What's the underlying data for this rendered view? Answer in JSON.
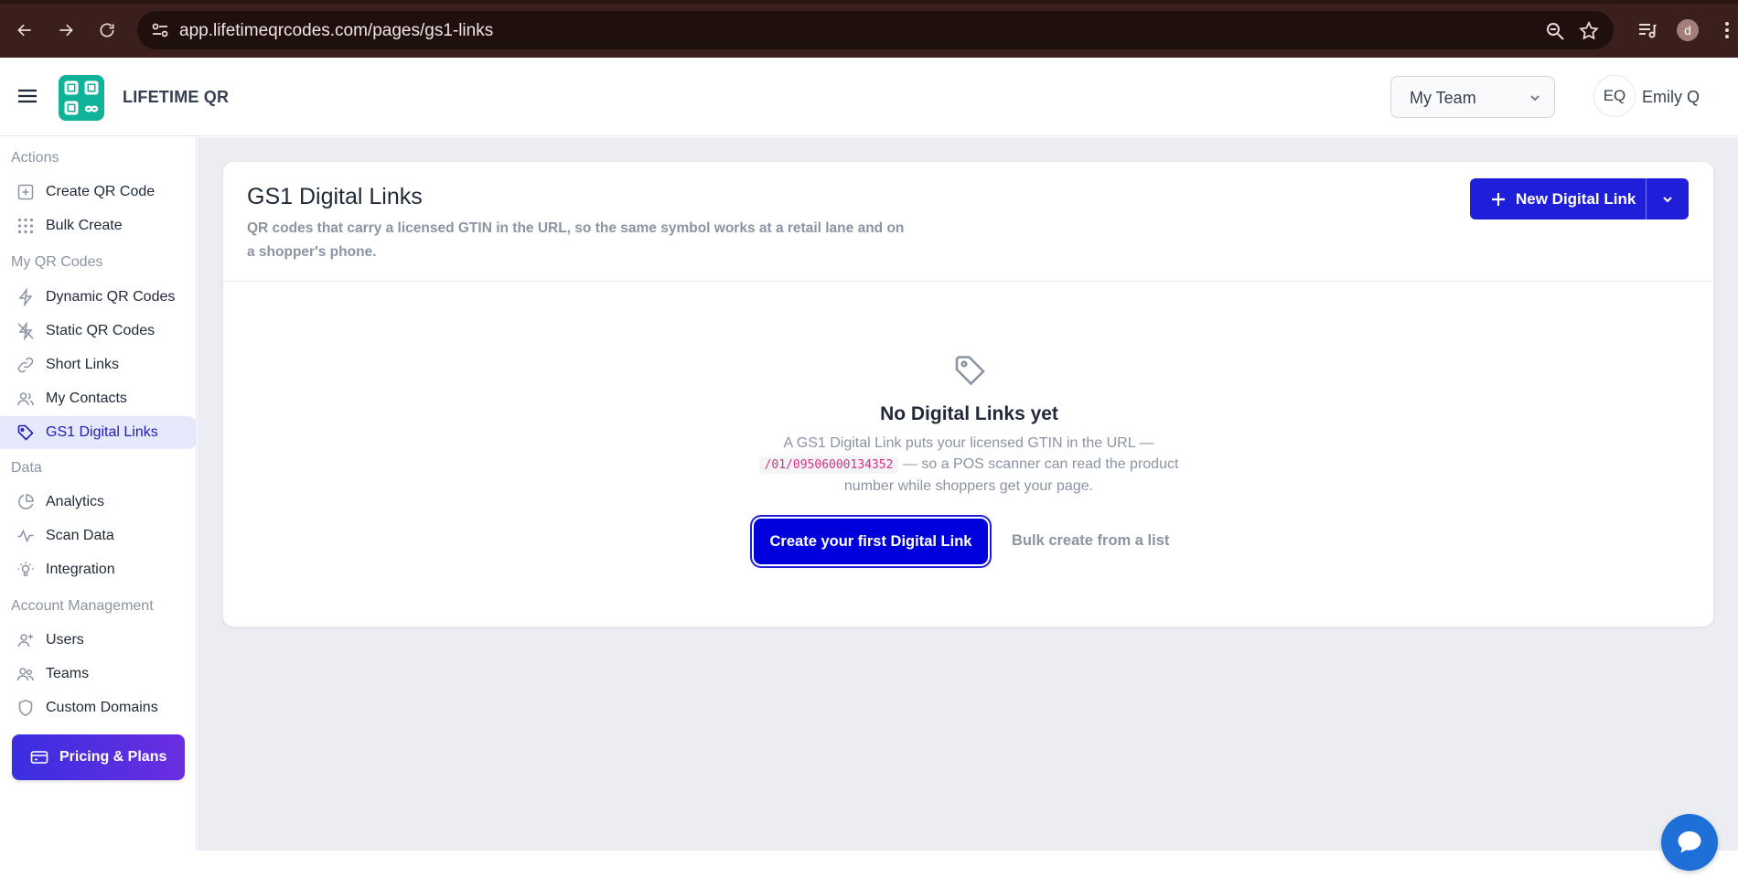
{
  "browser": {
    "url": "app.lifetimeqrcodes.com/pages/gs1-links",
    "profile_initial": "d"
  },
  "header": {
    "brand": "LIFETIME QR",
    "team_select": "My Team",
    "user_initials": "EQ",
    "user_name": "Emily Q"
  },
  "sidebar": {
    "sections": [
      {
        "title": "Actions",
        "items": [
          {
            "label": "Create QR Code",
            "icon": "plus-square-icon"
          },
          {
            "label": "Bulk Create",
            "icon": "grid-dots-icon"
          }
        ]
      },
      {
        "title": "My QR Codes",
        "items": [
          {
            "label": "Dynamic QR Codes",
            "icon": "lightning-icon"
          },
          {
            "label": "Static QR Codes",
            "icon": "lightning-off-icon"
          },
          {
            "label": "Short Links",
            "icon": "link-icon"
          },
          {
            "label": "My Contacts",
            "icon": "users-icon"
          },
          {
            "label": "GS1 Digital Links",
            "icon": "tag-icon",
            "active": true
          }
        ]
      },
      {
        "title": "Data",
        "items": [
          {
            "label": "Analytics",
            "icon": "pie-chart-icon"
          },
          {
            "label": "Scan Data",
            "icon": "activity-icon"
          },
          {
            "label": "Integration",
            "icon": "bulb-icon"
          }
        ]
      },
      {
        "title": "Account Management",
        "items": [
          {
            "label": "Users",
            "icon": "user-plus-icon"
          },
          {
            "label": "Teams",
            "icon": "team-icon"
          },
          {
            "label": "Custom Domains",
            "icon": "shield-icon"
          }
        ]
      }
    ],
    "pricing_label": "Pricing & Plans"
  },
  "main": {
    "title": "GS1 Digital Links",
    "subtitle": "QR codes that carry a licensed GTIN in the URL, so the same symbol works at a retail lane and on a shopper's phone.",
    "new_button_label": "New Digital Link",
    "empty": {
      "title": "No Digital Links yet",
      "desc_before": "A GS1 Digital Link puts your licensed GTIN in the URL —",
      "code": "/01/09506000134352",
      "desc_after": "— so a POS scanner can read the product number while shoppers get your page.",
      "primary_cta": "Create your first Digital Link",
      "secondary_cta": "Bulk create from a list"
    }
  },
  "colors": {
    "accent": "#1f1fd9",
    "logo": "#10b39a",
    "chrome": "#3b1f1c",
    "main_bg": "#ecedf2"
  }
}
